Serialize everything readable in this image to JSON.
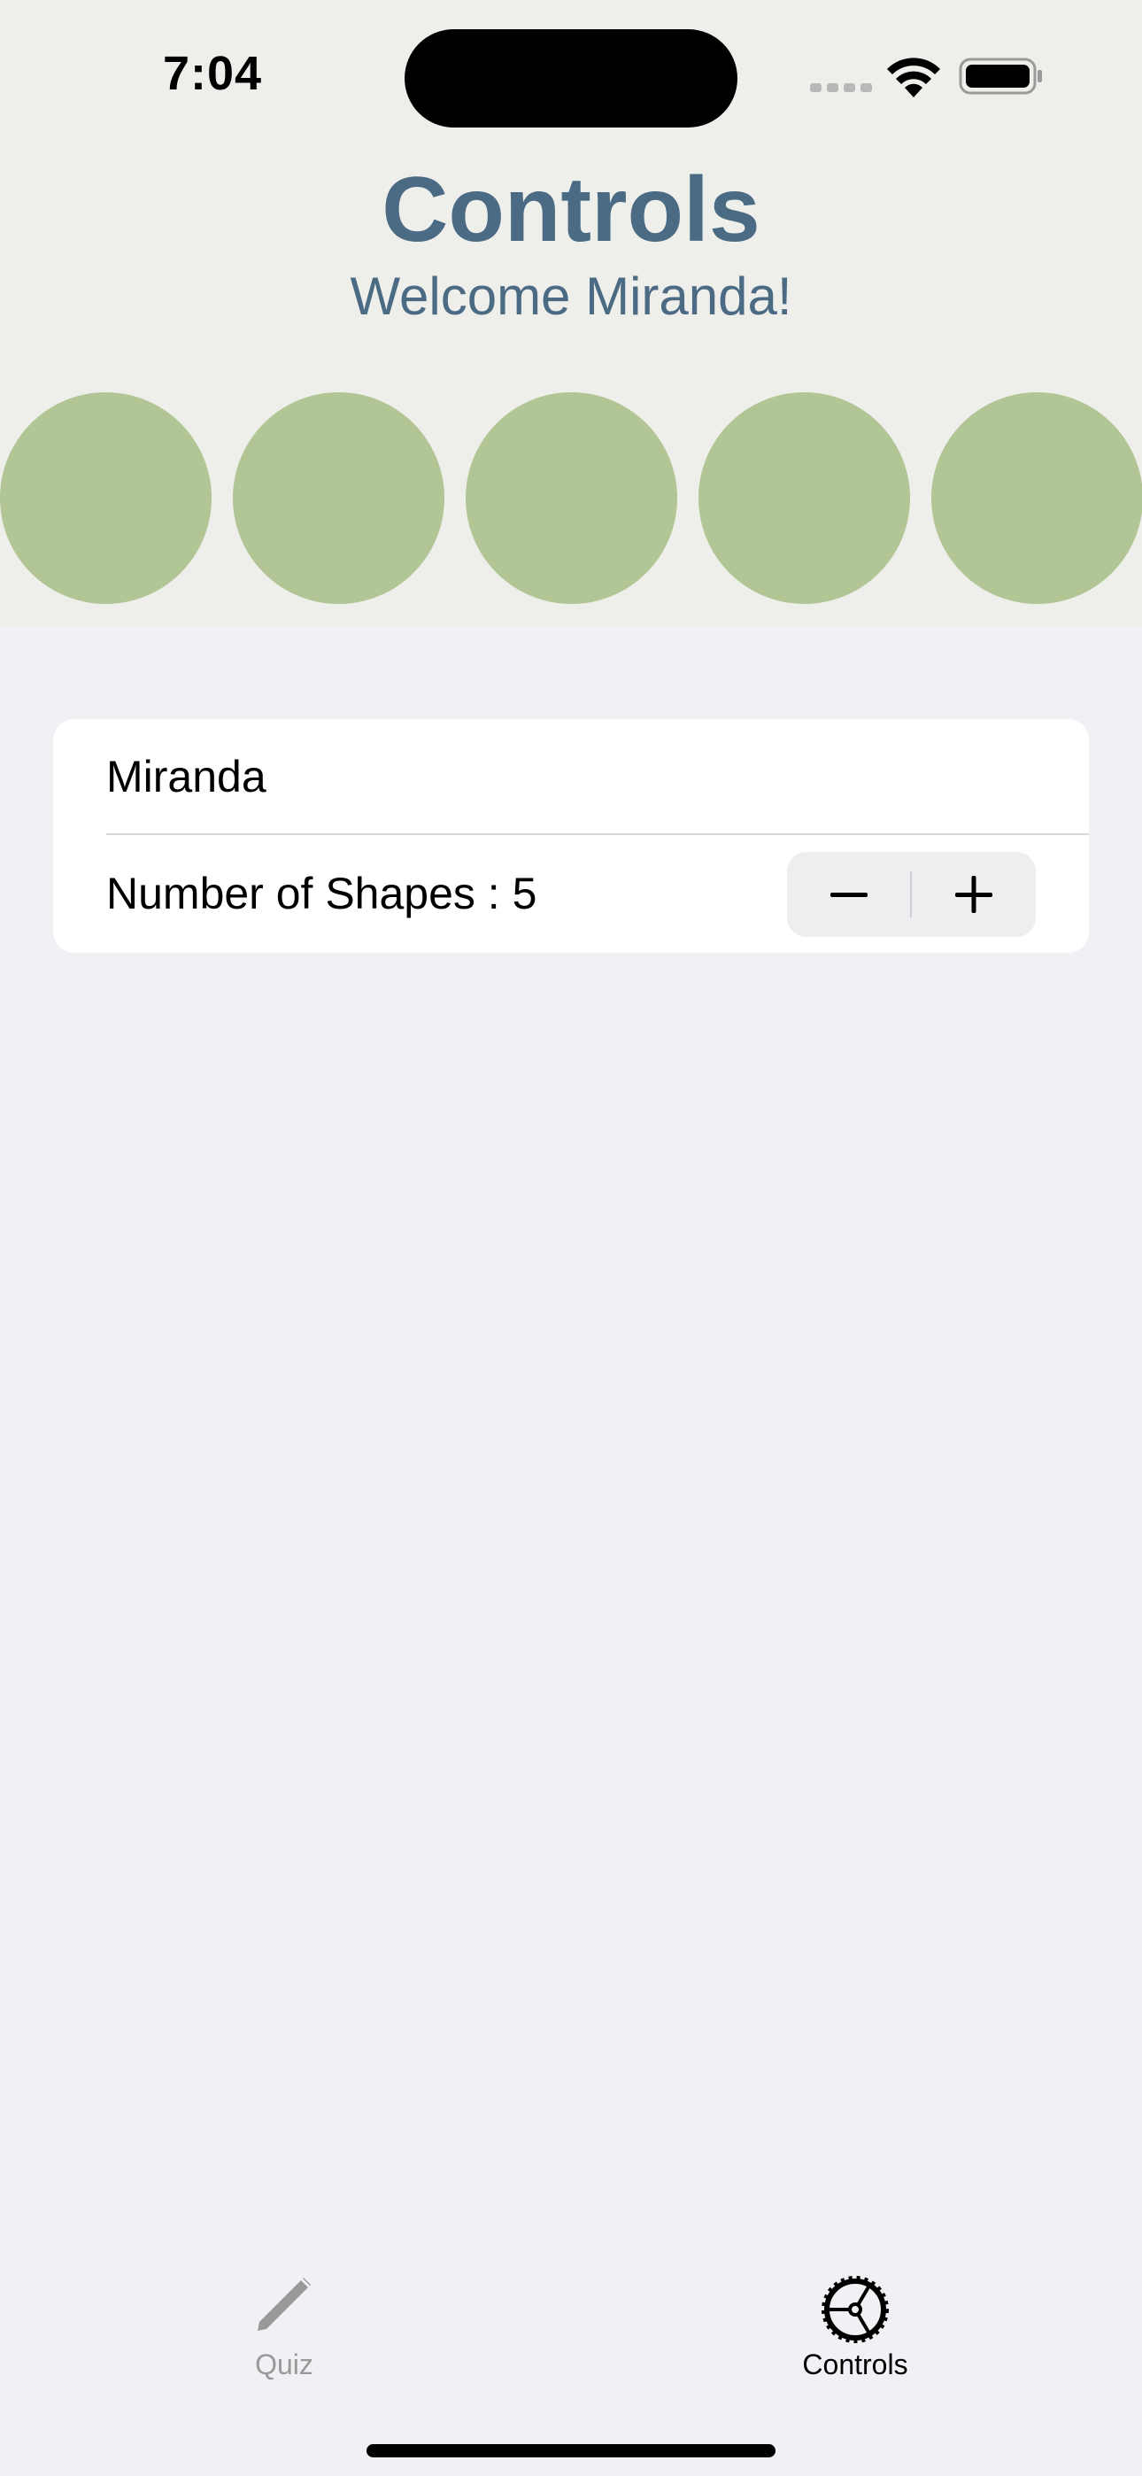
{
  "status_bar": {
    "time": "7:04",
    "icons": [
      "cellular-signal-icon",
      "wifi-icon",
      "battery-icon"
    ]
  },
  "header": {
    "title": "Controls",
    "subtitle": "Welcome Miranda!",
    "background_color": "#eeeeea",
    "text_color": "#4b6a84"
  },
  "shapes": {
    "count": 5,
    "kind": "circle",
    "color": "#b2c595"
  },
  "settings": {
    "name_value": "Miranda",
    "shapes_label": "Number of Shapes : 5",
    "stepper": {
      "decrement_icon": "minus-icon",
      "increment_icon": "plus-icon"
    }
  },
  "tab_bar": {
    "tabs": [
      {
        "label": "Quiz",
        "icon": "pencil-icon",
        "selected": false
      },
      {
        "label": "Controls",
        "icon": "steering-wheel-icon",
        "selected": true
      }
    ]
  }
}
